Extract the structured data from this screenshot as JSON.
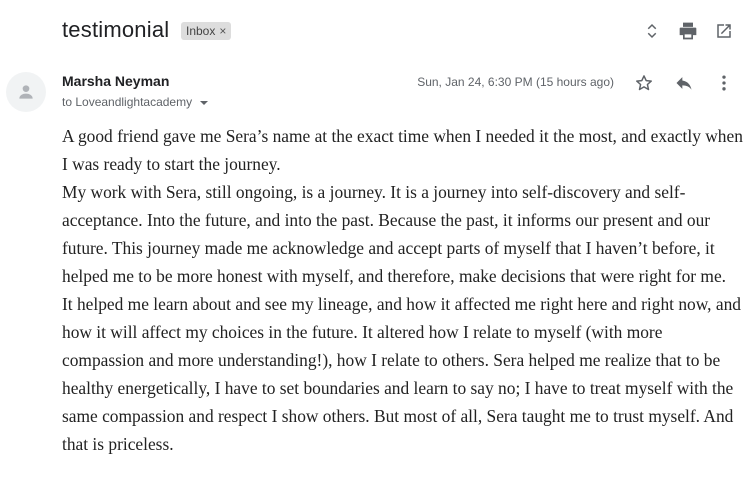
{
  "subject": {
    "title": "testimonial",
    "label": "Inbox",
    "label_remove": "×"
  },
  "icons": {
    "expand": "unfold-more-icon",
    "print": "print-icon",
    "new_window": "open-in-new-icon",
    "avatar": "person-icon",
    "star": "star-icon",
    "reply": "reply-icon",
    "more": "more-vert-icon"
  },
  "message": {
    "sender_name": "Marsha Neyman",
    "recipient": "to Loveandlightacademy",
    "date": "Sun, Jan 24, 6:30 PM (15 hours ago)",
    "paragraphs": [
      "A good friend gave me Sera’s name at the exact time when I needed it the most, and exactly when I was ready to start the journey.",
      "My work with Sera, still ongoing, is a journey. It is a journey into self-discovery and self-acceptance. Into the future, and into the past. Because the past, it informs our present and our future. This journey made me acknowledge and accept parts of myself that I haven’t before, it helped me to be more honest with myself, and therefore, make decisions that were right for me.",
      "It helped me learn about and see my lineage, and how it affected me right here and right now, and how it will affect my choices in the future. It altered how I relate to myself (with more compassion and more understanding!), how I relate to others. Sera helped me realize that to be healthy energetically, I have to set boundaries and learn to say no; I have to treat myself with the same compassion and respect I show others.  But most of all, Sera taught me to trust myself. And that is priceless."
    ]
  },
  "colors": {
    "icon_gray": "#5f6368",
    "chip_bg": "#dddddd",
    "text": "#202124"
  }
}
